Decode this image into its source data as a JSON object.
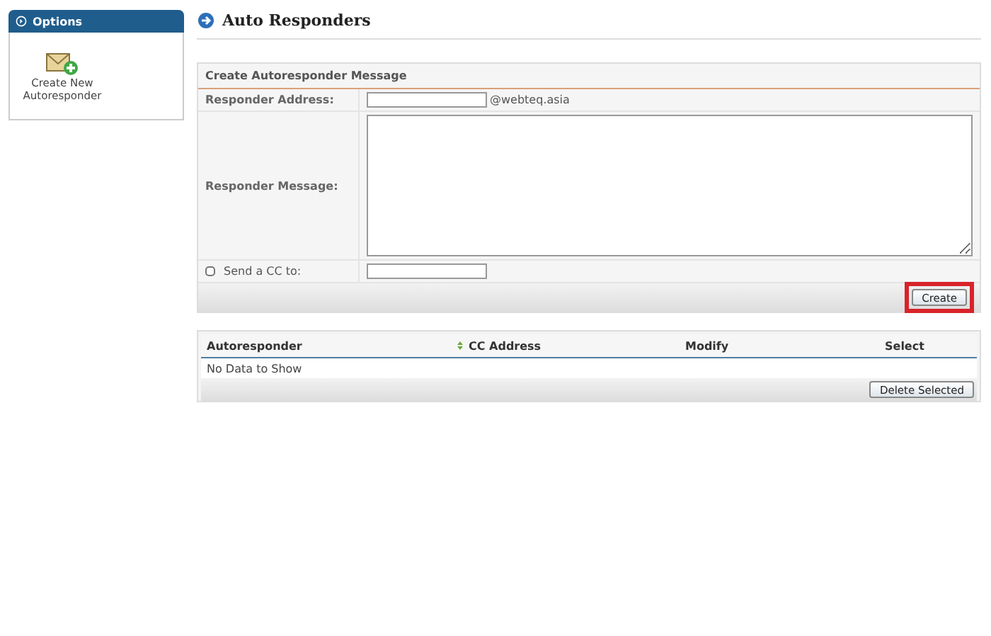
{
  "sidebar": {
    "title": "Options",
    "items": [
      {
        "label": "Create New Autoresponder"
      }
    ]
  },
  "page": {
    "title": "Auto Responders"
  },
  "form": {
    "title": "Create Autoresponder Message",
    "address": {
      "label": "Responder Address:",
      "suffix": "@webteq.asia"
    },
    "message": {
      "label": "Responder Message:"
    },
    "cc": {
      "label": "Send a CC to:",
      "checked": false
    },
    "create_button": {
      "label": "Create",
      "highlighted": true
    }
  },
  "table": {
    "columns": [
      {
        "label": "Autoresponder",
        "sortable": true
      },
      {
        "label": "CC Address",
        "sortable": false
      },
      {
        "label": "Modify",
        "sortable": false
      },
      {
        "label": "Select",
        "sortable": false
      }
    ],
    "empty_text": "No Data to Show",
    "delete_button": "Delete Selected"
  }
}
